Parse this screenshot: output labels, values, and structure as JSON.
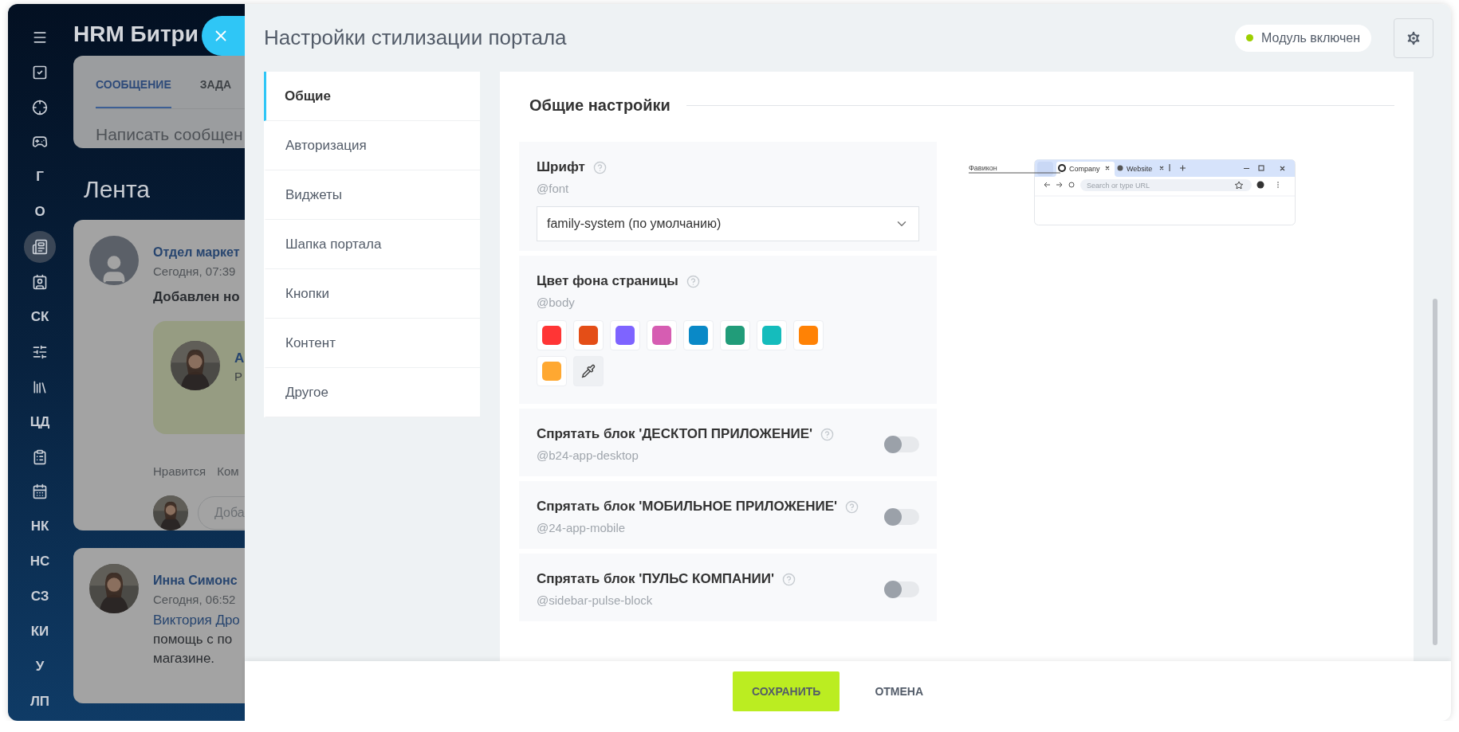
{
  "background_page": {
    "logo": "HRM Битри",
    "sidebar": [
      {
        "kind": "icon",
        "selected": false
      },
      {
        "kind": "icon",
        "selected": false
      },
      {
        "kind": "icon",
        "selected": false
      },
      {
        "kind": "icon",
        "selected": false
      },
      {
        "kind": "text",
        "label": "Г",
        "selected": false
      },
      {
        "kind": "text",
        "label": "О",
        "selected": false
      },
      {
        "kind": "icon",
        "selected": true
      },
      {
        "kind": "icon",
        "selected": false
      },
      {
        "kind": "text",
        "label": "СК",
        "selected": false
      },
      {
        "kind": "icon",
        "selected": false
      },
      {
        "kind": "icon",
        "selected": false
      },
      {
        "kind": "text",
        "label": "ЦД",
        "selected": false
      },
      {
        "kind": "icon",
        "selected": false
      },
      {
        "kind": "icon",
        "selected": false
      },
      {
        "kind": "text",
        "label": "НК",
        "selected": false
      },
      {
        "kind": "text",
        "label": "НС",
        "selected": false
      },
      {
        "kind": "text",
        "label": "СЗ",
        "selected": false
      },
      {
        "kind": "text",
        "label": "КИ",
        "selected": false
      },
      {
        "kind": "text",
        "label": "У",
        "selected": false
      },
      {
        "kind": "text",
        "label": "ЛП",
        "selected": false
      }
    ],
    "composer": {
      "tabs": [
        {
          "label": "СООБЩЕНИЕ",
          "selected": true
        },
        {
          "label": "ЗАДА",
          "selected": false
        }
      ],
      "placeholder": "Написать сообщен"
    },
    "feed_title": "Лента",
    "posts": [
      {
        "author": "Отдел маркет",
        "time": "Сегодня, 07:39",
        "text": "Добавлен но",
        "card_lines": [
          "А",
          "Р"
        ],
        "actions": [
          "Нравится",
          "Ком"
        ],
        "comment_placeholder": "Доба"
      },
      {
        "author": "Инна Симонс",
        "time": "Сегодня, 06:52",
        "link": "Виктория Дро",
        "lines": [
          "помощь с по",
          "магазине."
        ]
      }
    ]
  },
  "panel": {
    "title": "Настройки стилизации портала",
    "status": {
      "label": "Модуль включен",
      "on": true
    },
    "menu": [
      {
        "label": "Общие",
        "selected": true
      },
      {
        "label": "Авторизация",
        "selected": false
      },
      {
        "label": "Виджеты",
        "selected": false
      },
      {
        "label": "Шапка портала",
        "selected": false
      },
      {
        "label": "Кнопки",
        "selected": false
      },
      {
        "label": "Контент",
        "selected": false
      },
      {
        "label": "Другое",
        "selected": false
      }
    ],
    "heading": "Общие настройки",
    "sections": [
      {
        "kind": "select",
        "title": "Шрифт",
        "variable": "@font",
        "value": "family-system (по умолчанию)"
      },
      {
        "kind": "colors",
        "title": "Цвет фона страницы",
        "variable": "@body",
        "swatches": [
          {
            "color": "#ff3535"
          },
          {
            "color": "#e44e17"
          },
          {
            "color": "#7e64ff"
          },
          {
            "color": "#d65db2"
          },
          {
            "color": "#0a89c7"
          },
          {
            "color": "#219c79"
          },
          {
            "color": "#15bcbc"
          },
          {
            "color": "#ff8205"
          },
          {
            "color": "#ffa831"
          }
        ]
      },
      {
        "kind": "toggle",
        "title": "Спрятать блок 'ДЕСКТОП ПРИЛОЖЕНИЕ'",
        "variable": "@b24-app-desktop",
        "on": false
      },
      {
        "kind": "toggle",
        "title": "Спрятать блок 'МОБИЛЬНОЕ ПРИЛОЖЕНИЕ'",
        "variable": "@24-app-mobile",
        "on": false
      },
      {
        "kind": "toggle",
        "title": "Спрятать блок 'ПУЛЬС КОМПАНИИ'",
        "variable": "@sidebar-pulse-block",
        "on": false
      }
    ],
    "preview": {
      "label": "Фавикон",
      "tabs": [
        "Company",
        "Website"
      ],
      "url_placeholder": "Search or type URL"
    },
    "buttons": [
      {
        "label": "СОХРАНИТЬ",
        "kind": "primary"
      },
      {
        "label": "ОТМЕНА",
        "kind": "link"
      }
    ]
  }
}
